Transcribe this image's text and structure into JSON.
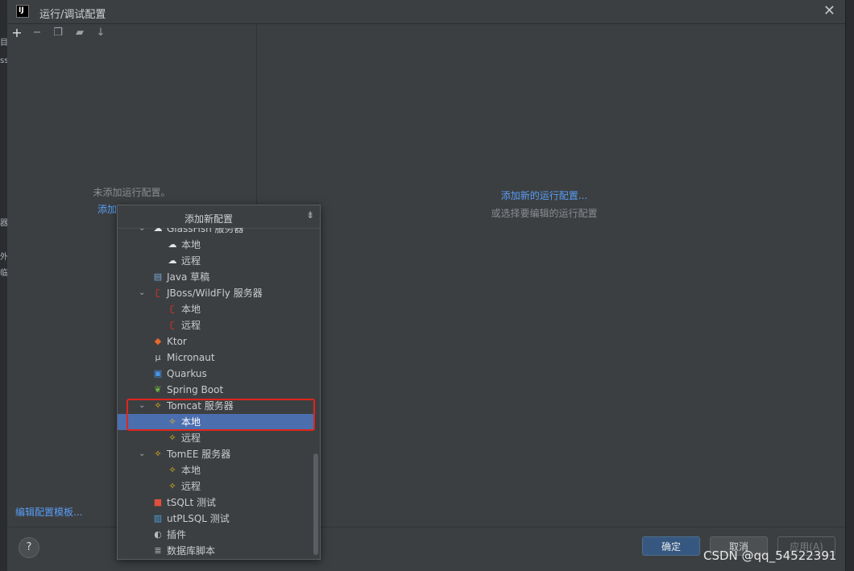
{
  "dialog": {
    "title": "运行/调试配置",
    "app_logo": "IJ"
  },
  "left_panel": {
    "empty_message": "未添加运行配置。",
    "add_link": "添加新...",
    "edit_templates": "编辑配置模板..."
  },
  "right_panel": {
    "add_link": "添加新的运行配置...",
    "hint": "或选择要编辑的运行配置"
  },
  "popup": {
    "title": "添加新配置",
    "items": [
      {
        "label": "GlassFish 服务器",
        "icon": "glassfish-icon",
        "expanded": true
      },
      {
        "label": "本地",
        "icon": "glassfish-icon"
      },
      {
        "label": "远程",
        "icon": "glassfish-icon"
      },
      {
        "label": "Java 草稿",
        "icon": "java-scratch-icon"
      },
      {
        "label": "JBoss/WildFly 服务器",
        "icon": "jboss-icon",
        "expanded": true
      },
      {
        "label": "本地",
        "icon": "jboss-icon"
      },
      {
        "label": "远程",
        "icon": "jboss-icon"
      },
      {
        "label": "Ktor",
        "icon": "ktor-icon"
      },
      {
        "label": "Micronaut",
        "icon": "micronaut-icon"
      },
      {
        "label": "Quarkus",
        "icon": "quarkus-icon"
      },
      {
        "label": "Spring Boot",
        "icon": "spring-boot-icon"
      },
      {
        "label": "Tomcat 服务器",
        "icon": "tomcat-icon",
        "expanded": true
      },
      {
        "label": "本地",
        "icon": "tomcat-icon",
        "selected": true
      },
      {
        "label": "远程",
        "icon": "tomcat-icon"
      },
      {
        "label": "TomEE 服务器",
        "icon": "tomee-icon",
        "expanded": true
      },
      {
        "label": "本地",
        "icon": "tomee-icon"
      },
      {
        "label": "远程",
        "icon": "tomee-icon"
      },
      {
        "label": "tSQLt 测试",
        "icon": "tsqlt-icon"
      },
      {
        "label": "utPLSQL 测试",
        "icon": "utplsql-icon"
      },
      {
        "label": "插件",
        "icon": "plugin-icon"
      },
      {
        "label": "数据库脚本",
        "icon": "database-script-icon"
      }
    ]
  },
  "buttons": {
    "ok": "确定",
    "cancel": "取消",
    "apply": "应用(A)",
    "help": "?"
  },
  "watermark": "CSDN @qq_54522391",
  "colors": {
    "selection": "#4b6eaf",
    "link": "#589df6",
    "highlight_border": "#e0251b"
  }
}
